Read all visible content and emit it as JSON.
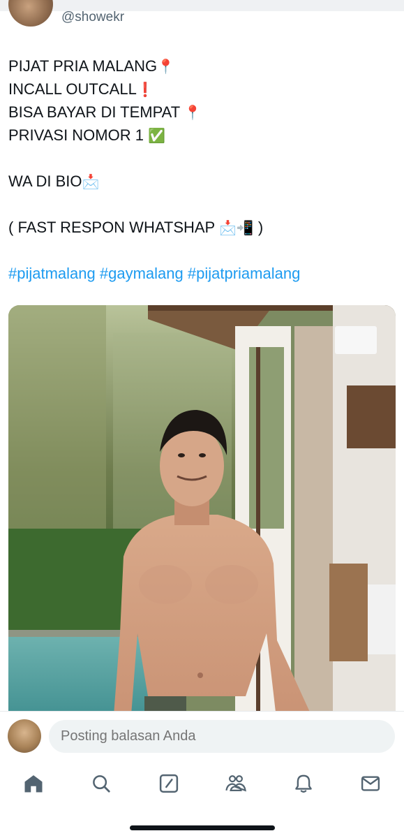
{
  "tweet": {
    "handle": "@showekr",
    "lines": [
      {
        "text": "PIJAT PRIA MALANG",
        "emoji": "📍"
      },
      {
        "text": "INCALL OUTCALL",
        "emoji": "❗"
      },
      {
        "text": "BISA BAYAR DI TEMPAT ",
        "emoji": "📍"
      },
      {
        "text": "PRIVASI NOMOR 1 ",
        "emoji": "✅"
      },
      {
        "text": "WA DI BIO",
        "emoji": "📩"
      },
      {
        "text": "( FAST RESPON WHATSHAP ",
        "emoji": "📩📲",
        "suffix": " )"
      }
    ],
    "hashtags": [
      "#pijatmalang",
      "#gaymalang",
      "#pijatpriamalang"
    ]
  },
  "reply": {
    "placeholder": "Posting balasan Anda"
  },
  "nav": {
    "items": [
      "home",
      "search",
      "compose",
      "communities",
      "notifications",
      "messages"
    ]
  },
  "colors": {
    "link": "#1d9bf0",
    "text": "#0f1419",
    "muted": "#536471",
    "input_bg": "#eff3f4"
  }
}
